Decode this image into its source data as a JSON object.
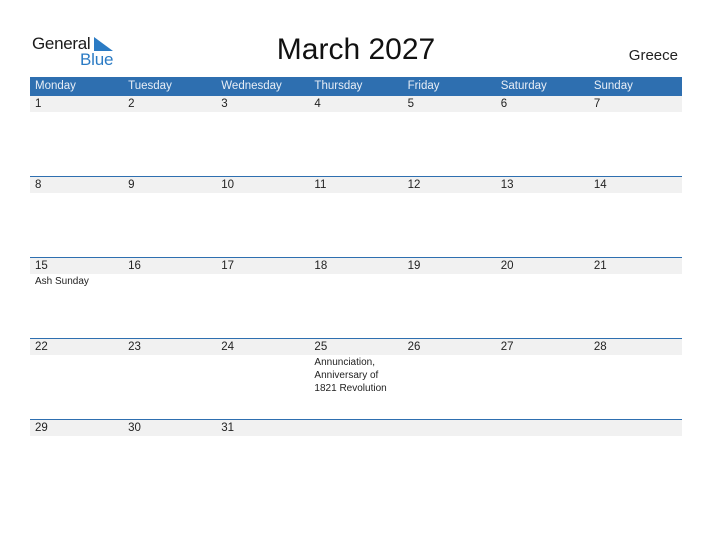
{
  "logo": {
    "general": "General",
    "blue": "Blue",
    "accent_color": "#2b7bc4"
  },
  "title": "March 2027",
  "country": "Greece",
  "colors": {
    "header_bg": "#2e6fb0",
    "row_band": "#f1f1f1"
  },
  "weekdays": [
    "Monday",
    "Tuesday",
    "Wednesday",
    "Thursday",
    "Friday",
    "Saturday",
    "Sunday"
  ],
  "weeks": [
    [
      {
        "day": "1",
        "holiday": ""
      },
      {
        "day": "2",
        "holiday": ""
      },
      {
        "day": "3",
        "holiday": ""
      },
      {
        "day": "4",
        "holiday": ""
      },
      {
        "day": "5",
        "holiday": ""
      },
      {
        "day": "6",
        "holiday": ""
      },
      {
        "day": "7",
        "holiday": ""
      }
    ],
    [
      {
        "day": "8",
        "holiday": ""
      },
      {
        "day": "9",
        "holiday": ""
      },
      {
        "day": "10",
        "holiday": ""
      },
      {
        "day": "11",
        "holiday": ""
      },
      {
        "day": "12",
        "holiday": ""
      },
      {
        "day": "13",
        "holiday": ""
      },
      {
        "day": "14",
        "holiday": ""
      }
    ],
    [
      {
        "day": "15",
        "holiday": "Ash Sunday"
      },
      {
        "day": "16",
        "holiday": ""
      },
      {
        "day": "17",
        "holiday": ""
      },
      {
        "day": "18",
        "holiday": ""
      },
      {
        "day": "19",
        "holiday": ""
      },
      {
        "day": "20",
        "holiday": ""
      },
      {
        "day": "21",
        "holiday": ""
      }
    ],
    [
      {
        "day": "22",
        "holiday": ""
      },
      {
        "day": "23",
        "holiday": ""
      },
      {
        "day": "24",
        "holiday": ""
      },
      {
        "day": "25",
        "holiday": "Annunciation, Anniversary of 1821 Revolution"
      },
      {
        "day": "26",
        "holiday": ""
      },
      {
        "day": "27",
        "holiday": ""
      },
      {
        "day": "28",
        "holiday": ""
      }
    ],
    [
      {
        "day": "29",
        "holiday": ""
      },
      {
        "day": "30",
        "holiday": ""
      },
      {
        "day": "31",
        "holiday": ""
      },
      {
        "day": "",
        "holiday": ""
      },
      {
        "day": "",
        "holiday": ""
      },
      {
        "day": "",
        "holiday": ""
      },
      {
        "day": "",
        "holiday": ""
      }
    ]
  ]
}
